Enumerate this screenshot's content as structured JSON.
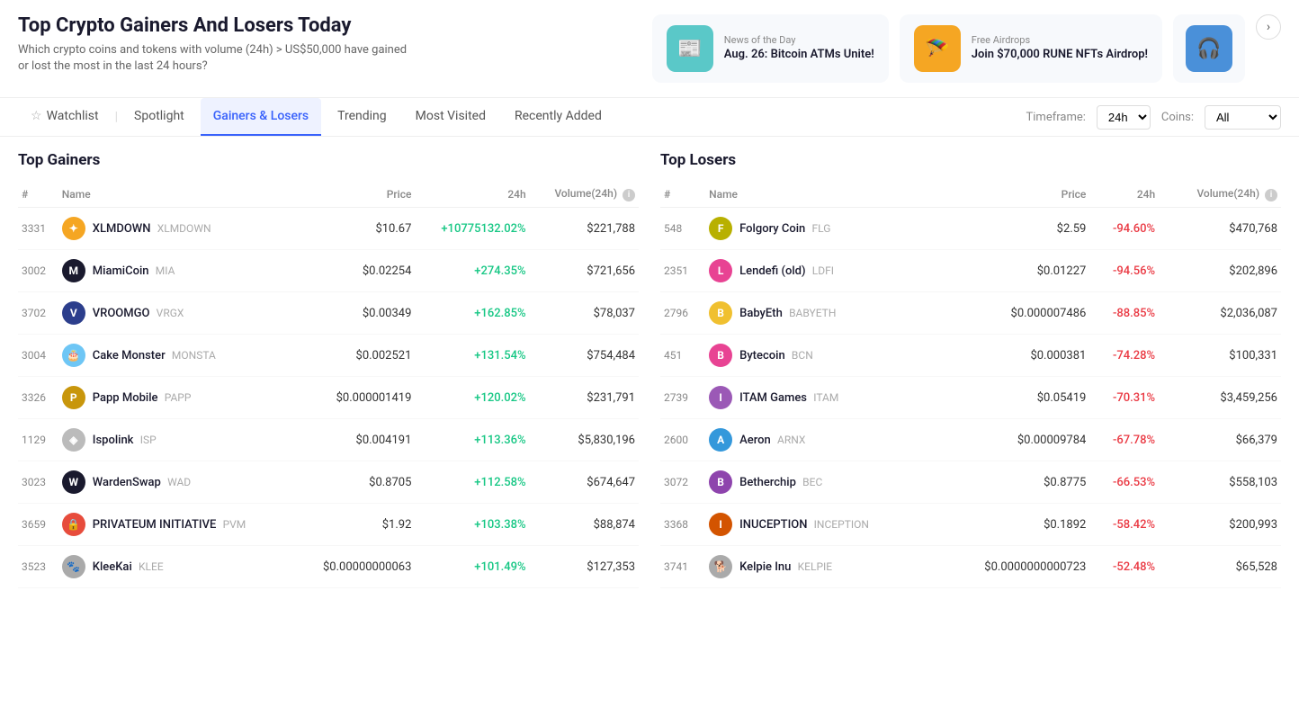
{
  "header": {
    "title": "Top Crypto Gainers And Losers Today",
    "subtitle": "Which crypto coins and tokens with volume (24h) > US$50,000 have gained or lost the most in the last 24 hours?"
  },
  "news_cards": [
    {
      "id": "news1",
      "label": "News of the Day",
      "title": "Aug. 26: Bitcoin ATMs Unite!",
      "icon": "📰",
      "icon_class": "teal"
    },
    {
      "id": "news2",
      "label": "Free Airdrops",
      "title": "Join $70,000 RUNE NFTs Airdrop!",
      "icon": "🪂",
      "icon_class": "orange"
    },
    {
      "id": "news3",
      "label": "",
      "title": "",
      "icon": "🎧",
      "icon_class": "blue"
    }
  ],
  "nav": {
    "tabs": [
      {
        "id": "watchlist",
        "label": "Watchlist",
        "active": false,
        "watchlist": true
      },
      {
        "id": "spotlight",
        "label": "Spotlight",
        "active": false
      },
      {
        "id": "gainers-losers",
        "label": "Gainers & Losers",
        "active": true
      },
      {
        "id": "trending",
        "label": "Trending",
        "active": false
      },
      {
        "id": "most-visited",
        "label": "Most Visited",
        "active": false
      },
      {
        "id": "recently-added",
        "label": "Recently Added",
        "active": false
      }
    ],
    "timeframe_label": "Timeframe:",
    "timeframe_value": "24h",
    "coins_label": "Coins:",
    "coins_value": "All"
  },
  "gainers": {
    "title": "Top Gainers",
    "columns": [
      "#",
      "Name",
      "Price",
      "24h",
      "Volume(24h)"
    ],
    "rows": [
      {
        "rank": "3331",
        "name": "XLMDOWN",
        "symbol": "XLMDOWN",
        "price": "$10.67",
        "change": "+10775132.02%",
        "volume": "$221,788",
        "icon_bg": "#f5a623",
        "icon_text": "✦"
      },
      {
        "rank": "3002",
        "name": "MiamiCoin",
        "symbol": "MIA",
        "price": "$0.02254",
        "change": "+274.35%",
        "volume": "$721,656",
        "icon_bg": "#1a1a2e",
        "icon_text": "M"
      },
      {
        "rank": "3702",
        "name": "VROOMGO",
        "symbol": "VRGX",
        "price": "$0.00349",
        "change": "+162.85%",
        "volume": "$78,037",
        "icon_bg": "#2c3e8c",
        "icon_text": "V"
      },
      {
        "rank": "3004",
        "name": "Cake Monster",
        "symbol": "MONSTA",
        "price": "$0.002521",
        "change": "+131.54%",
        "volume": "$754,484",
        "icon_bg": "#6ec6f5",
        "icon_text": "🎂"
      },
      {
        "rank": "3326",
        "name": "Papp Mobile",
        "symbol": "PAPP",
        "price": "$0.000001419",
        "change": "+120.02%",
        "volume": "$231,791",
        "icon_bg": "#c8960c",
        "icon_text": "P"
      },
      {
        "rank": "1129",
        "name": "Ispolink",
        "symbol": "ISP",
        "price": "$0.004191",
        "change": "+113.36%",
        "volume": "$5,830,196",
        "icon_bg": "#bbb",
        "icon_text": "◈"
      },
      {
        "rank": "3023",
        "name": "WardenSwap",
        "symbol": "WAD",
        "price": "$0.8705",
        "change": "+112.58%",
        "volume": "$674,647",
        "icon_bg": "#1a1a2e",
        "icon_text": "W"
      },
      {
        "rank": "3659",
        "name": "PRIVATEUM INITIATIVE",
        "symbol": "PVM",
        "price": "$1.92",
        "change": "+103.38%",
        "volume": "$88,874",
        "icon_bg": "#e74c3c",
        "icon_text": "🔒"
      },
      {
        "rank": "3523",
        "name": "KleeKai",
        "symbol": "KLEE",
        "price": "$0.00000000063",
        "change": "+101.49%",
        "volume": "$127,353",
        "icon_bg": "#aaa",
        "icon_text": "🐾"
      }
    ]
  },
  "losers": {
    "title": "Top Losers",
    "columns": [
      "#",
      "Name",
      "Price",
      "24h",
      "Volume(24h)"
    ],
    "rows": [
      {
        "rank": "548",
        "name": "Folgory Coin",
        "symbol": "FLG",
        "price": "$2.59",
        "change": "-94.60%",
        "volume": "$470,768",
        "icon_bg": "#b8b000",
        "icon_text": "F"
      },
      {
        "rank": "2351",
        "name": "Lendefi (old)",
        "symbol": "LDFI",
        "price": "$0.01227",
        "change": "-94.56%",
        "volume": "$202,896",
        "icon_bg": "#e84393",
        "icon_text": "L"
      },
      {
        "rank": "2796",
        "name": "BabyEth",
        "symbol": "BABYETH",
        "price": "$0.000007486",
        "change": "-88.85%",
        "volume": "$2,036,087",
        "icon_bg": "#f0c030",
        "icon_text": "B"
      },
      {
        "rank": "451",
        "name": "Bytecoin",
        "symbol": "BCN",
        "price": "$0.000381",
        "change": "-74.28%",
        "volume": "$100,331",
        "icon_bg": "#e84393",
        "icon_text": "B"
      },
      {
        "rank": "2739",
        "name": "ITAM Games",
        "symbol": "ITAM",
        "price": "$0.05419",
        "change": "-70.31%",
        "volume": "$3,459,256",
        "icon_bg": "#9b59b6",
        "icon_text": "I"
      },
      {
        "rank": "2600",
        "name": "Aeron",
        "symbol": "ARNX",
        "price": "$0.00009784",
        "change": "-67.78%",
        "volume": "$66,379",
        "icon_bg": "#3498db",
        "icon_text": "A"
      },
      {
        "rank": "3072",
        "name": "Betherchip",
        "symbol": "BEC",
        "price": "$0.8775",
        "change": "-66.53%",
        "volume": "$558,103",
        "icon_bg": "#8e44ad",
        "icon_text": "B"
      },
      {
        "rank": "3368",
        "name": "INUCEPTION",
        "symbol": "INCEPTION",
        "price": "$0.1892",
        "change": "-58.42%",
        "volume": "$200,993",
        "icon_bg": "#d35400",
        "icon_text": "I"
      },
      {
        "rank": "3741",
        "name": "Kelpie Inu",
        "symbol": "KELPIE",
        "price": "$0.0000000000723",
        "change": "-52.48%",
        "volume": "$65,528",
        "icon_bg": "#aaa",
        "icon_text": "🐕"
      }
    ]
  }
}
